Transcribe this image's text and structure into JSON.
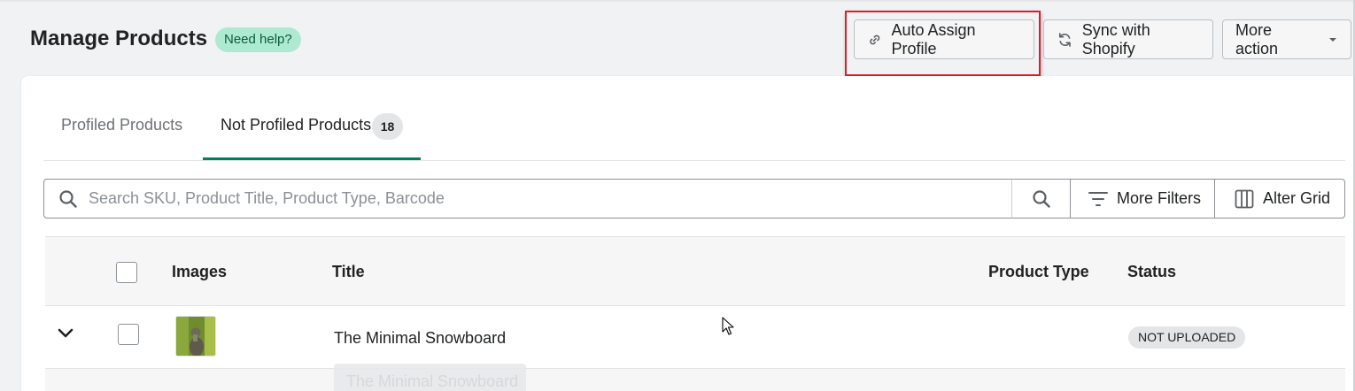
{
  "page": {
    "title": "Manage Products",
    "help_badge": "Need help?"
  },
  "header_actions": {
    "auto_assign": {
      "label": "Auto Assign Profile",
      "icon": "link-icon"
    },
    "sync": {
      "label": "Sync with Shopify",
      "icon": "refresh-icon"
    },
    "more": {
      "label": "More action",
      "icon": "caret-down-icon"
    }
  },
  "tabs": [
    {
      "label": "Profiled Products",
      "selected": false
    },
    {
      "label": "Not Profiled Products",
      "count": "18",
      "selected": true
    }
  ],
  "toolbar": {
    "search_placeholder": "Search SKU, Product Title, Product Type, Barcode",
    "search_value": "",
    "more_filters": "More Filters",
    "alter_grid": "Alter Grid"
  },
  "table": {
    "columns": [
      "Images",
      "Title",
      "Product Type",
      "Status"
    ],
    "rows": [
      {
        "title": "The Minimal Snowboard",
        "product_type": "",
        "status": "NOT UPLOADED",
        "drag_label": "The Minimal Snowboard"
      }
    ]
  },
  "colors": {
    "accent": "#008060",
    "help_badge_bg": "#aee9d1",
    "highlight": "#d9202b",
    "status_badge_bg": "#e4e5e7"
  }
}
